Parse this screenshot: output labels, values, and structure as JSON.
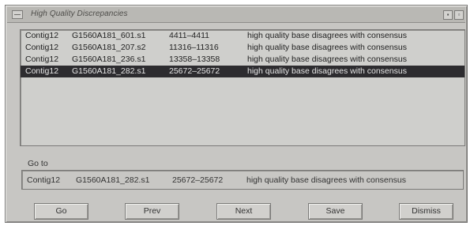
{
  "window": {
    "title": "High Quality Discrepancies",
    "minimize_glyph": "▪",
    "maximize_glyph": "▫"
  },
  "list": {
    "rows": [
      {
        "contig": "Contig12",
        "read": "G1560A181_601.s1",
        "range": "4411–4411",
        "desc": "high quality base disagrees with consensus",
        "selected": false
      },
      {
        "contig": "Contig12",
        "read": "G1560A181_207.s2",
        "range": "11316–11316",
        "desc": "high quality base disagrees with consensus",
        "selected": false
      },
      {
        "contig": "Contig12",
        "read": "G1560A181_236.s1",
        "range": "13358–13358",
        "desc": "high quality base disagrees with consensus",
        "selected": false
      },
      {
        "contig": "Contig12",
        "read": "G1560A181_282.s1",
        "range": "25672–25672",
        "desc": "high quality base disagrees with consensus",
        "selected": true
      }
    ]
  },
  "goto": {
    "label": "Go to",
    "contig": "Contig12",
    "read": "G1560A181_282.s1",
    "range": "25672–25672",
    "desc": "high quality base disagrees with consensus"
  },
  "buttons": {
    "go": "Go",
    "prev": "Prev",
    "next": "Next",
    "save": "Save",
    "dismiss": "Dismiss"
  }
}
